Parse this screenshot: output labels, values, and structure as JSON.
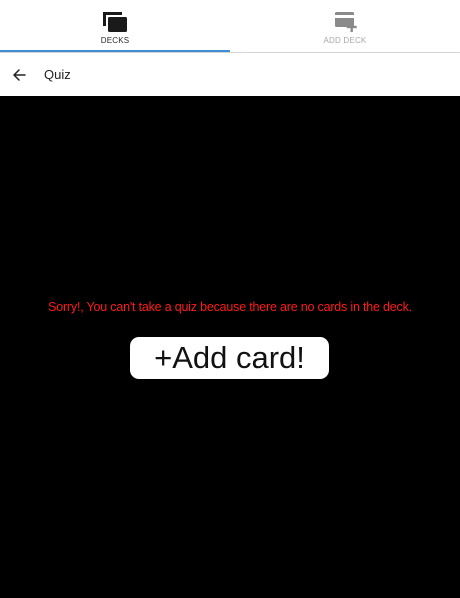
{
  "tabs": [
    {
      "label": "DECKS",
      "icon": "decks-icon",
      "active": true
    },
    {
      "label": "ADD DECK",
      "icon": "add-deck-icon",
      "active": false
    }
  ],
  "header": {
    "back_icon": "arrow-left-icon",
    "title": "Quiz"
  },
  "main": {
    "message": "Sorry!, You can't take a quiz because there are no cards in the deck.",
    "add_card_label": "+Add card!"
  },
  "colors": {
    "accent": "#3e8fd6",
    "message": "#ff1a1a",
    "background": "#000000"
  }
}
